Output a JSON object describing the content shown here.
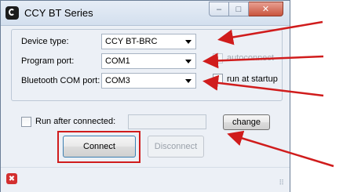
{
  "window": {
    "title": "CCY BT Series",
    "caption_buttons": {
      "minimize": "–",
      "maximize": "□",
      "close": "✕"
    }
  },
  "form": {
    "device_type": {
      "label": "Device type:",
      "value": "CCY BT-BRC"
    },
    "program_port": {
      "label": "Program port:",
      "value": "COM1"
    },
    "bluetooth_port": {
      "label": "Bluetooth COM port:",
      "value": "COM3"
    },
    "autoconnect": {
      "label": "autoconnect",
      "checked": false,
      "enabled": false
    },
    "run_at_startup": {
      "label": "run at startup",
      "checked": false,
      "enabled": true
    },
    "run_after_connected": {
      "label": "Run after connected:",
      "checked": false,
      "path": ""
    }
  },
  "buttons": {
    "change": "change",
    "connect": "Connect",
    "disconnect": "Disconnect"
  },
  "statusbar": {
    "icon": "error-icon",
    "icon_glyph": "✖",
    "grip": "⠿"
  },
  "annotations": {
    "arrow_color": "#d01c1c",
    "highlight_color": "#d01c1c",
    "arrow_count": 4
  }
}
